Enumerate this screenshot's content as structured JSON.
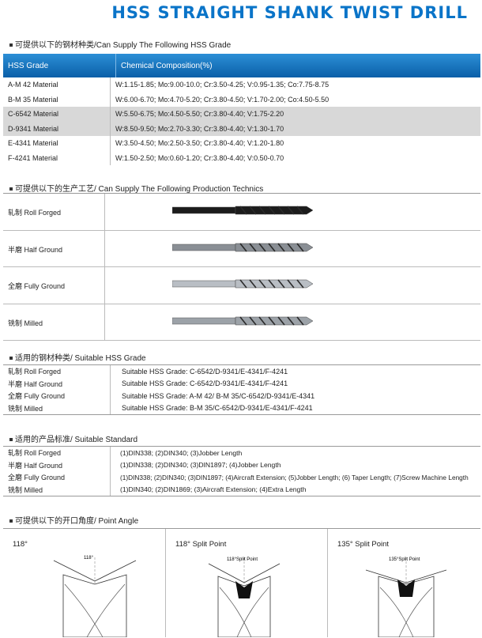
{
  "title": "HSS STRAIGHT SHANK TWIST DRILL",
  "sections": {
    "grade": "可提供以下的钢材种类/Can Supply The Following HSS Grade",
    "technics": "可提供以下的生产工艺/ Can Supply The Following Production Technics",
    "suitable_grade": "适用的钢材种类/ Suitable HSS Grade",
    "suitable_standard": "适用的产品标准/ Suitable Standard",
    "point_angle": "可提供以下的开口角度/ Point Angle"
  },
  "grade_table": {
    "headers": [
      "HSS Grade",
      "Chemical Composition(%)"
    ],
    "rows": [
      {
        "grade": "A-M 42 Material",
        "comp": "W:1.15-1.85; Mo:9.00-10.0; Cr:3.50-4.25; V:0.95-1.35; Co:7.75-8.75"
      },
      {
        "grade": "B-M 35 Material",
        "comp": "W:6.00-6.70; Mo:4.70-5.20; Cr:3.80-4.50; V:1.70-2.00; Co:4.50-5.50"
      },
      {
        "grade": "C-6542 Material",
        "comp": "W:5.50-6.75; Mo:4.50-5.50; Cr:3.80-4.40; V:1.75-2.20"
      },
      {
        "grade": "D-9341 Material",
        "comp": "W:8.50-9.50; Mo:2.70-3.30; Cr:3.80-4.40; V:1.30-1.70"
      },
      {
        "grade": "E-4341 Material",
        "comp": "W:3.50-4.50; Mo:2.50-3.50; Cr:3.80-4.40; V:1.20-1.80"
      },
      {
        "grade": "F-4241 Material",
        "comp": "W:1.50-2.50; Mo:0.60-1.20; Cr:3.80-4.40; V:0.50-0.70"
      }
    ]
  },
  "technics": [
    {
      "label": "轧制 Roll Forged",
      "color": "#1c1c1c"
    },
    {
      "label": "半磨 Half Ground",
      "color": "#8a8f95"
    },
    {
      "label": "全磨 Fully Ground",
      "color": "#b9bec4"
    },
    {
      "label": "铣制 Milled",
      "color": "#9ca2a8"
    }
  ],
  "suitable_grade": [
    {
      "label": "轧制 Roll Forged",
      "value": "Suitable HSS Grade: C-6542/D-9341/E-4341/F-4241"
    },
    {
      "label": "半磨 Half Ground",
      "value": "Suitable HSS Grade: C-6542/D-9341/E-4341/F-4241"
    },
    {
      "label": "全磨 Fully Ground",
      "value": "Suitable HSS Grade: A-M 42/ B-M 35/C-6542/D-9341/E-4341"
    },
    {
      "label": "铣制 Milled",
      "value": "Suitable HSS Grade: B-M 35/C-6542/D-9341/E-4341/F-4241"
    }
  ],
  "suitable_standard": [
    {
      "label": "轧制 Roll Forged",
      "value": "(1)DIN338; (2)DIN340; (3)Jobber Length"
    },
    {
      "label": "半磨 Half Ground",
      "value": "(1)DIN338; (2)DIN340; (3)DIN1897; (4)Jobber Length"
    },
    {
      "label": "全磨 Fully Ground",
      "value": "(1)DIN338; (2)DIN340; (3)DIN1897; (4)Aircraft Extension; (5)Jobber Length; (6) Taper Length; (7)Screw Machine Length"
    },
    {
      "label": "铣制 Milled",
      "value": "(1)DIN340; (2)DIN1869; (3)Aircraft Extension; (4)Extra Length"
    }
  ],
  "point_angle": [
    {
      "title": "118°",
      "tag": "118°"
    },
    {
      "title": "118°  Split Point",
      "tag": "118°Split Point"
    },
    {
      "title": "135°  Split Point",
      "tag": "135°Split Point"
    }
  ]
}
